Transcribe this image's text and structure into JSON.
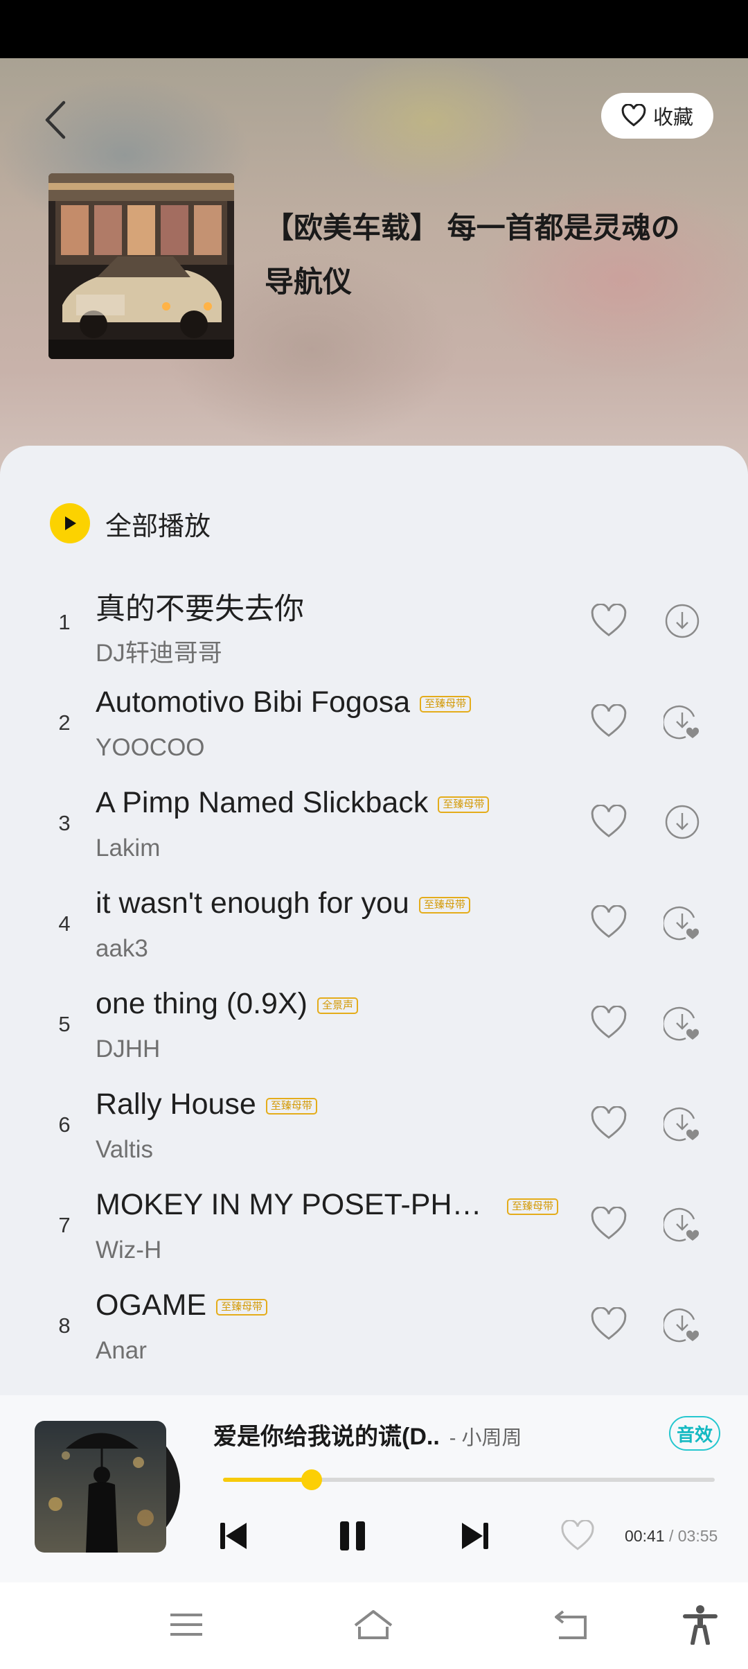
{
  "header": {
    "favorite_label": "收藏",
    "playlist_title": "【欧美车载】 每一首都是灵魂の导航仪"
  },
  "play_all_label": "全部播放",
  "songs": [
    {
      "num": "1",
      "title": "真的不要失去你",
      "artist": "DJ轩迪哥哥",
      "badge": "",
      "downloaded": false
    },
    {
      "num": "2",
      "title": "Automotivo Bibi Fogosa",
      "artist": "YOOCOO",
      "badge": "至臻母带",
      "downloaded": true
    },
    {
      "num": "3",
      "title": "A Pimp Named Slickback",
      "artist": "Lakim",
      "badge": "至臻母带",
      "downloaded": false
    },
    {
      "num": "4",
      "title": "it wasn't enough for you",
      "artist": "aak3",
      "badge": "至臻母带",
      "downloaded": true
    },
    {
      "num": "5",
      "title": "one thing (0.9X)",
      "artist": "DJHH",
      "badge": "全景声",
      "downloaded": true
    },
    {
      "num": "6",
      "title": "Rally House",
      "artist": "Valtis",
      "badge": "至臻母带",
      "downloaded": true
    },
    {
      "num": "7",
      "title": "MOKEY IN MY POSET-PHO...",
      "artist": "Wiz-H",
      "badge": "至臻母带",
      "downloaded": true
    },
    {
      "num": "8",
      "title": "OGAME",
      "artist": "Anar",
      "badge": "至臻母带",
      "downloaded": true
    }
  ],
  "now_playing": {
    "song": "爱是你给我说的谎(D..",
    "artist": "- 小周周",
    "effect_label": "音效",
    "elapsed": "00:41",
    "total": "/ 03:55",
    "progress": 0.18
  },
  "colors": {
    "accent": "#fcd200",
    "badge": "#d39a08",
    "effect": "#14b9c2"
  },
  "icons": {
    "back": "chevron-left-icon",
    "favorite": "heart-icon",
    "play_all": "play-icon",
    "download": "download-icon",
    "downloaded": "download-heart-icon",
    "prev": "skip-previous-icon",
    "pause": "pause-icon",
    "next": "skip-next-icon",
    "nav_menu": "menu-icon",
    "nav_home": "home-icon",
    "nav_back": "back-icon",
    "nav_accessibility": "accessibility-icon"
  }
}
